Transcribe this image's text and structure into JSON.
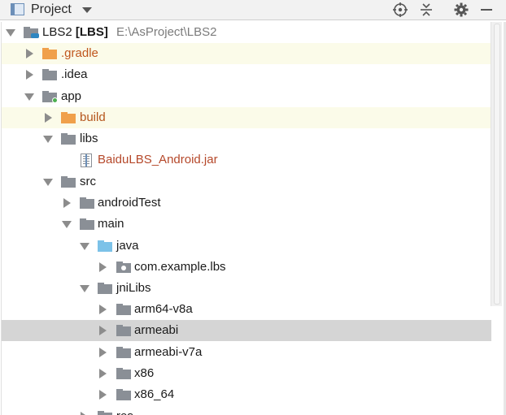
{
  "header": {
    "title": "Project",
    "icons": [
      "project-view-icon",
      "dropdown-caret-icon",
      "locate-icon",
      "collapse-all-icon",
      "settings-gear-icon",
      "hide-icon"
    ]
  },
  "tree": {
    "root": {
      "label": "LBS2",
      "module": "[LBS]",
      "path": "E:\\AsProject\\LBS2"
    },
    "items": [
      {
        "label": ".gradle"
      },
      {
        "label": ".idea"
      },
      {
        "label": "app"
      },
      {
        "label": "build"
      },
      {
        "label": "libs"
      },
      {
        "label": "BaiduLBS_Android.jar"
      },
      {
        "label": "src"
      },
      {
        "label": "androidTest"
      },
      {
        "label": "main"
      },
      {
        "label": "java"
      },
      {
        "label": "com.example.lbs"
      },
      {
        "label": "jniLibs"
      },
      {
        "label": "arm64-v8a"
      },
      {
        "label": "armeabi"
      },
      {
        "label": "armeabi-v7a"
      },
      {
        "label": "x86"
      },
      {
        "label": "x86_64"
      },
      {
        "label": "res"
      }
    ]
  },
  "colors": {
    "folder_gray": "#8a8f96",
    "folder_orange": "#f0a04b",
    "folder_blue": "#7cc2e8",
    "highlight_row": "#fbfbe9",
    "selected_row": "#d5d5d5",
    "excluded_text": "#c0571e",
    "path_text": "#7b7b7b"
  }
}
